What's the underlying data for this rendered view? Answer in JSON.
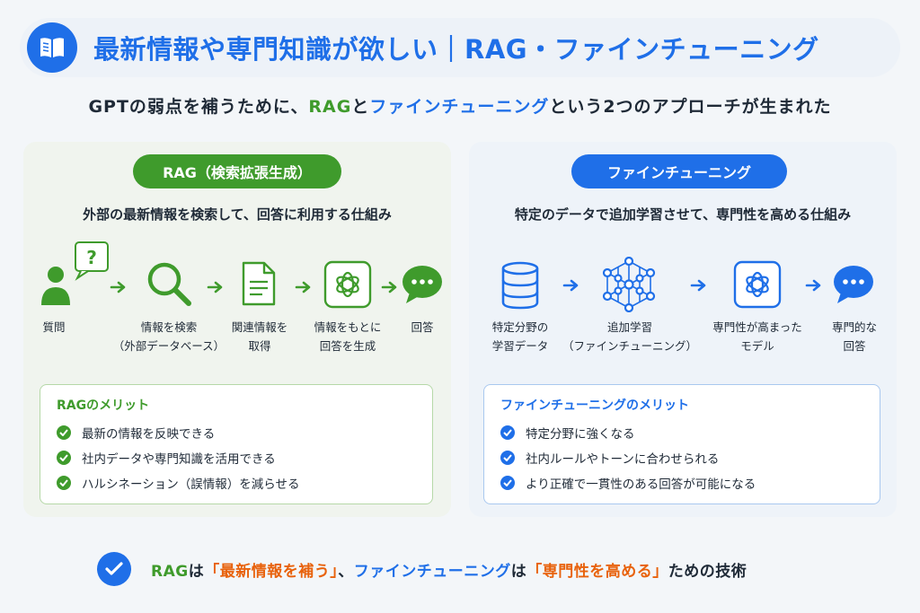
{
  "title": "最新情報や専門知識が欲しい｜RAG・ファインチューニング",
  "subtitle": {
    "pre": "GPTの弱点を補うために、",
    "rag": "RAG",
    "mid": "と",
    "ft": "ファインチューニング",
    "post": "という2つのアプローチが生まれた"
  },
  "rag_panel": {
    "badge": "RAG（検索拡張生成）",
    "description": "外部の最新情報を検索して、回答に利用する仕組み",
    "steps": [
      {
        "icon": "user-question-icon",
        "line1": "質問",
        "line2": ""
      },
      {
        "icon": "search-icon",
        "line1": "情報を検索",
        "line2": "（外部データベース）"
      },
      {
        "icon": "document-icon",
        "line1": "関連情報を",
        "line2": "取得"
      },
      {
        "icon": "ai-logo-icon",
        "line1": "情報をもとに",
        "line2": "回答を生成"
      },
      {
        "icon": "chat-bubble-icon",
        "line1": "回答",
        "line2": ""
      }
    ],
    "merit_title": "RAGのメリット",
    "merits": [
      "最新の情報を反映できる",
      "社内データや専門知識を活用できる",
      "ハルシネーション（誤情報）を減らせる"
    ]
  },
  "ft_panel": {
    "badge": "ファインチューニング",
    "description": "特定のデータで追加学習させて、専門性を高める仕組み",
    "steps": [
      {
        "icon": "database-icon",
        "line1": "特定分野の",
        "line2": "学習データ"
      },
      {
        "icon": "neural-network-icon",
        "line1": "追加学習",
        "line2": "（ファインチューニング）"
      },
      {
        "icon": "ai-logo-icon",
        "line1": "専門性が高まった",
        "line2": "モデル"
      },
      {
        "icon": "chat-bubble-icon",
        "line1": "専門的な",
        "line2": "回答"
      }
    ],
    "merit_title": "ファインチューニングのメリット",
    "merits": [
      "特定分野に強くなる",
      "社内ルールやトーンに合わせられる",
      "より正確で一貫性のある回答が可能になる"
    ]
  },
  "summary": {
    "rag": "RAG",
    "p1": "は",
    "q1": "「最新情報を補う」",
    "p2": "、",
    "ft": "ファインチューニング",
    "p3": "は",
    "q2": "「専門性を高める」",
    "p4": "ための技術"
  },
  "colors": {
    "rag_green": "#3f9b2c",
    "ft_blue": "#1f6fe8",
    "accent_orange": "#e8620c"
  }
}
